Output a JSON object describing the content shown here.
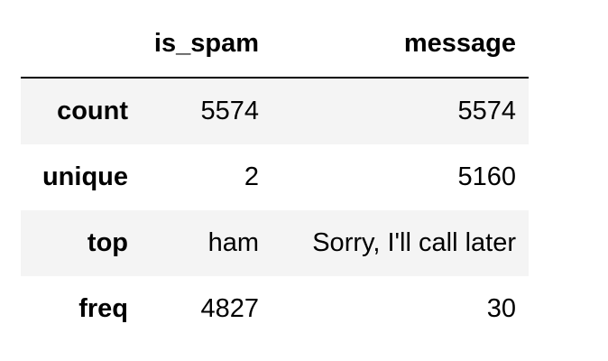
{
  "table": {
    "columns": [
      "is_spam",
      "message"
    ],
    "rows": [
      {
        "index": "count",
        "is_spam": "5574",
        "message": "5574"
      },
      {
        "index": "unique",
        "is_spam": "2",
        "message": "5160"
      },
      {
        "index": "top",
        "is_spam": "ham",
        "message": "Sorry, I'll call later"
      },
      {
        "index": "freq",
        "is_spam": "4827",
        "message": "30"
      }
    ]
  }
}
